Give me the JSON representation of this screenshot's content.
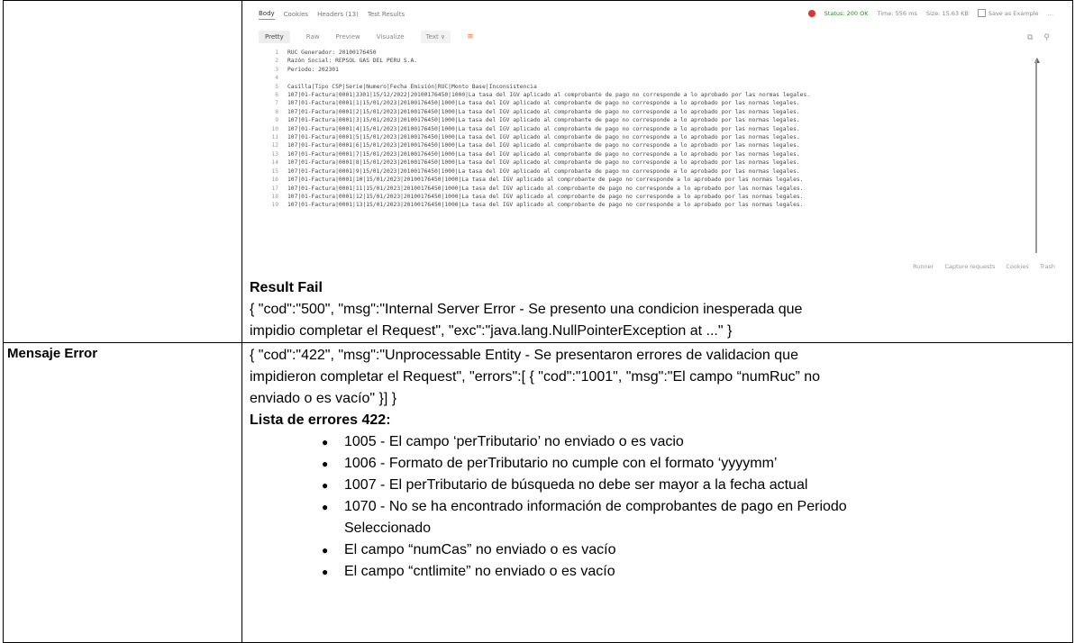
{
  "screenshot": {
    "tabs": [
      "Body",
      "Cookies",
      "Headers (13)",
      "Test Results"
    ],
    "status": "Status: 200 OK",
    "time": "Time: 556 ms",
    "size": "Size: 15.63 KB",
    "save_example": "Save as Example",
    "more": "…",
    "formats": [
      "Pretty",
      "Raw",
      "Preview",
      "Visualize"
    ],
    "text_select": "Text ∨",
    "footer": [
      "Runner",
      "Capture requests",
      "Cookies",
      "Trash"
    ],
    "lines": [
      {
        "n": "1",
        "t": "RUC Generador: 20100176450"
      },
      {
        "n": "2",
        "t": "Razón Social: REPSOL GAS DEL PERU S.A."
      },
      {
        "n": "3",
        "t": "Periodo: 202301"
      },
      {
        "n": "4",
        "t": ""
      },
      {
        "n": "5",
        "t": "Casilla|Tipo CSP|Serie|Numero|Fecha Emisión|RUC|Monto Base|Inconsistencia"
      },
      {
        "n": "6",
        "t": "107|01-Factura|0001|3301|15/12/2022|20100176450|1000|La tasa del IGV aplicado al comprobante de pago no corresponde a lo aprobado por las normas legales."
      },
      {
        "n": "7",
        "t": "107|01-Factura|0001|1|15/01/2023|20100176450|1000|La tasa del IGV aplicado al comprobante de pago no corresponde a lo aprobado por las normas legales."
      },
      {
        "n": "8",
        "t": "107|01-Factura|0001|2|15/01/2023|20100176450|1000|La tasa del IGV aplicado al comprobante de pago no corresponde a lo aprobado por las normas legales."
      },
      {
        "n": "9",
        "t": "107|01-Factura|0001|3|15/01/2023|20100176450|1000|La tasa del IGV aplicado al comprobante de pago no corresponde a lo aprobado por las normas legales."
      },
      {
        "n": "10",
        "t": "107|01-Factura|0001|4|15/01/2023|20100176450|1000|La tasa del IGV aplicado al comprobante de pago no corresponde a lo aprobado por las normas legales."
      },
      {
        "n": "11",
        "t": "107|01-Factura|0001|5|15/01/2023|20100176450|1000|La tasa del IGV aplicado al comprobante de pago no corresponde a lo aprobado por las normas legales."
      },
      {
        "n": "12",
        "t": "107|01-Factura|0001|6|15/01/2023|20100176450|1000|La tasa del IGV aplicado al comprobante de pago no corresponde a lo aprobado por las normas legales."
      },
      {
        "n": "13",
        "t": "107|01-Factura|0001|7|15/01/2023|20100176450|1000|La tasa del IGV aplicado al comprobante de pago no corresponde a lo aprobado por las normas legales."
      },
      {
        "n": "14",
        "t": "107|01-Factura|0001|8|15/01/2023|20100176450|1000|La tasa del IGV aplicado al comprobante de pago no corresponde a lo aprobado por las normas legales."
      },
      {
        "n": "15",
        "t": "107|01-Factura|0001|9|15/01/2023|20100176450|1000|La tasa del IGV aplicado al comprobante de pago no corresponde a lo aprobado por las normas legales."
      },
      {
        "n": "16",
        "t": "107|01-Factura|0001|10|15/01/2023|20100176450|1000|La tasa del IGV aplicado al comprobante de pago no corresponde a lo aprobado por las normas legales."
      },
      {
        "n": "17",
        "t": "107|01-Factura|0001|11|15/01/2023|20100176450|1000|La tasa del IGV aplicado al comprobante de pago no corresponde a lo aprobado por las normas legales."
      },
      {
        "n": "18",
        "t": "107|01-Factura|0001|12|15/01/2023|20100176450|1000|La tasa del IGV aplicado al comprobante de pago no corresponde a lo aprobado por las normas legales."
      },
      {
        "n": "19",
        "t": "107|01-Factura|0001|13|15/01/2023|20100176450|1000|La tasa del IGV aplicado al comprobante de pago no corresponde a lo aprobado por las normas legales."
      }
    ]
  },
  "result_fail": {
    "heading": "Result Fail",
    "line1": "{ \"cod\":\"500\", \"msg\":\"Internal Server Error - Se presento una condicion inesperada que",
    "line2": "impidio completar el Request\", \"exc\":\"java.lang.NullPointerException at ...\" }"
  },
  "mensaje_error": {
    "label": "Mensaje Error",
    "line1": "{ \"cod\":\"422\", \"msg\":\"Unprocessable Entity - Se presentaron errores de validacion que",
    "line2": "impidieron completar el Request\", \"errors\":[ { \"cod\":\"1001\", \"msg\":\"El campo “numRuc” no",
    "line3": "enviado o es vacío\" }] }",
    "list_heading": "Lista de errores 422:",
    "bullet": "●",
    "items": [
      "1005 - El campo ‘perTributario’ no enviado o es vacio",
      "1006 - Formato de perTributario no cumple con el formato ‘yyyymm’",
      "1007 - El perTributario de búsqueda no debe ser mayor a la fecha actual",
      "1070 - No se ha encontrado información de comprobantes de pago en Periodo",
      "Seleccionado",
      "El campo “numCas” no enviado o es vacío",
      "El campo “cntlimite” no enviado o es vacío"
    ]
  }
}
